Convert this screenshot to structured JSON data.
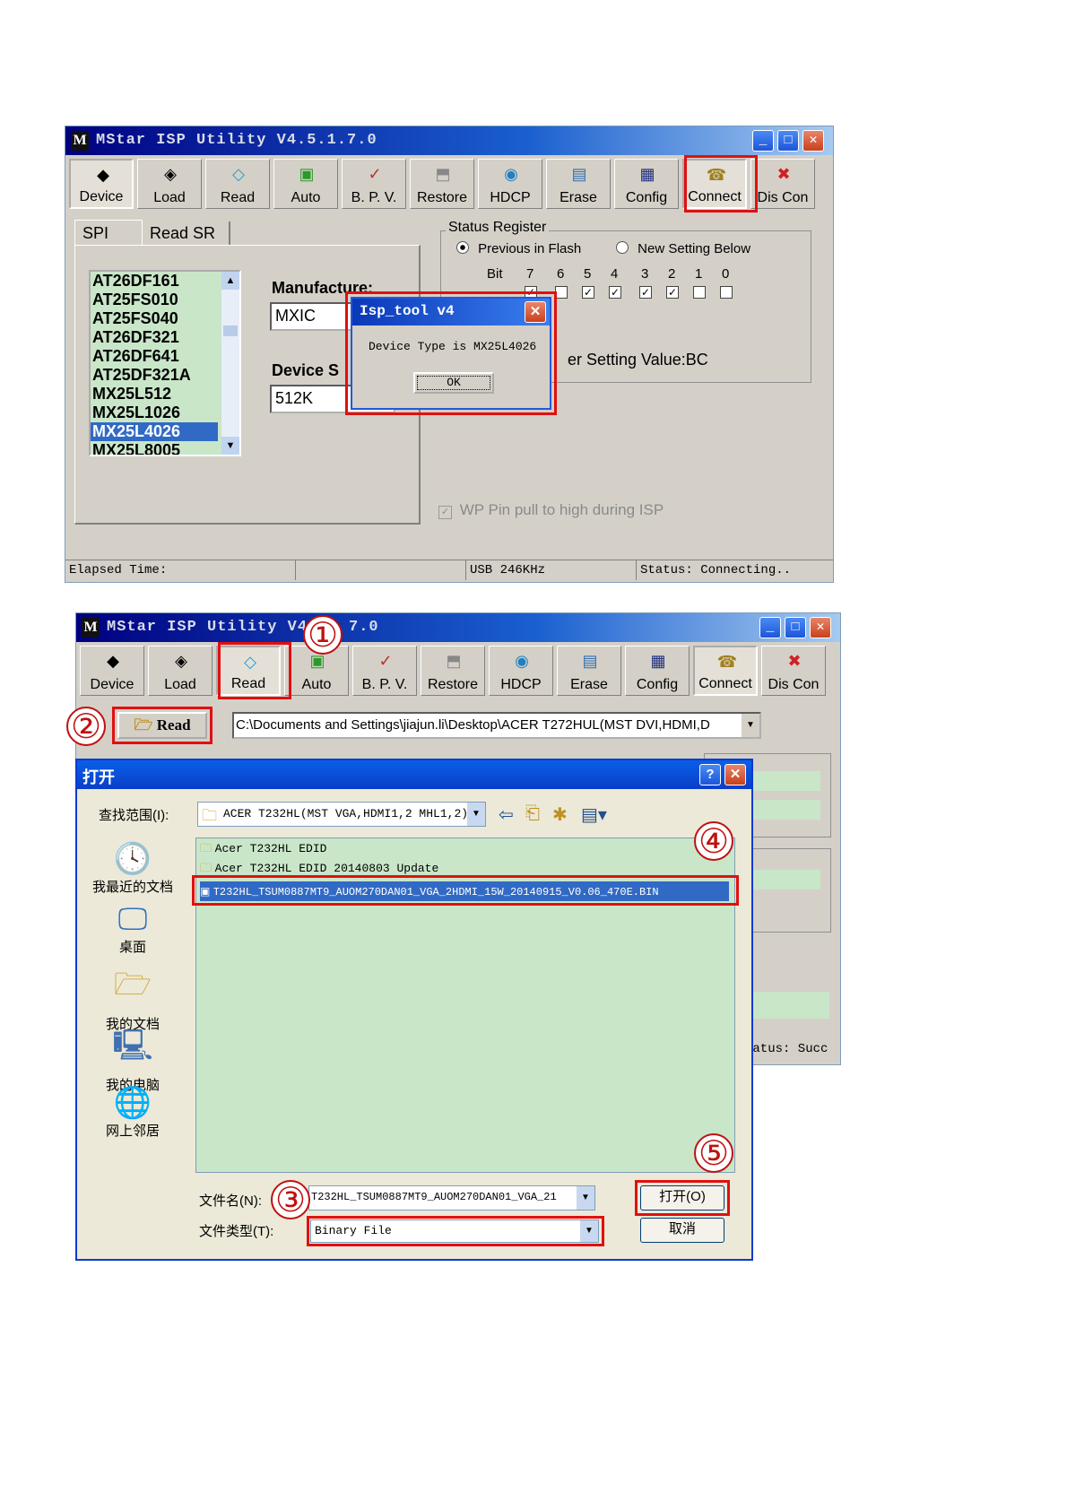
{
  "window1": {
    "title": "MStar ISP Utility V4.5.1.7.0",
    "toolbar": [
      "Device",
      "Load",
      "Read",
      "Auto",
      "B. P. V.",
      "Restore",
      "HDCP",
      "Erase",
      "Config",
      "Connect",
      "Dis Con"
    ],
    "tabs": [
      "SPI",
      "Read SR"
    ],
    "device_list": [
      "AT26DF161",
      "AT25FS010",
      "AT25FS040",
      "AT26DF321",
      "AT26DF641",
      "AT25DF321A",
      "MX25L512",
      "MX25L1026",
      "MX25L4026",
      "MX25L8005"
    ],
    "selected_device": "MX25L4026",
    "manufacture_label": "Manufacture:",
    "manufacture_value": "MXIC",
    "device_size_label": "Device S",
    "device_size_value": "512K",
    "status_register": {
      "title": "Status Register",
      "opt_previous": "Previous in Flash",
      "opt_new": "New Setting Below",
      "bit_label": "Bit",
      "bits": [
        "7",
        "6",
        "5",
        "4",
        "3",
        "2",
        "1",
        "0"
      ],
      "setting_value": "er Setting Value:BC"
    },
    "wp_label": "WP Pin pull to high during ISP",
    "dialog": {
      "title": "Isp_tool v4",
      "message": "Device Type is MX25L4026",
      "ok": "OK"
    },
    "statusbar": {
      "elapsed": "Elapsed Time:",
      "usb": "USB  246KHz",
      "status": "Status: Connecting.."
    }
  },
  "window2": {
    "title_a": "MStar ISP Utility V4",
    "title_b": "7.0",
    "toolbar": [
      "Device",
      "Load",
      "Read",
      "Auto",
      "B. P. V.",
      "Restore",
      "HDCP",
      "Erase",
      "Config",
      "Connect",
      "Dis Con"
    ],
    "read_button": "Read",
    "path": "C:\\Documents and Settings\\jiajun.li\\Desktop\\ACER T272HUL(MST DVI,HDMI,D",
    "status_partial": "tatus: Succ",
    "open_dialog": {
      "title": "打开",
      "lookin_label": "查找范围(I):",
      "lookin_value": "ACER T232HL(MST VGA,HDMI1,2 MHL1,2)",
      "places": [
        "我最近的文档",
        "桌面",
        "我的文档",
        "我的电脑",
        "网上邻居"
      ],
      "files": [
        "Acer T232HL EDID",
        "Acer T232HL EDID 20140803 Update",
        "T232HL_TSUM0887MT9_AUOM270DAN01_VGA_2HDMI_15W_20140915_V0.06_470E.BIN"
      ],
      "filename_label": "文件名(N):",
      "filename_value": "T232HL_TSUM0887MT9_AUOM270DAN01_VGA_21",
      "filetype_label": "文件类型(T):",
      "filetype_value": "Binary File",
      "open_btn": "打开(O)",
      "cancel_btn": "取消"
    }
  },
  "markers": [
    "①",
    "②",
    "③",
    "④",
    "⑤"
  ]
}
